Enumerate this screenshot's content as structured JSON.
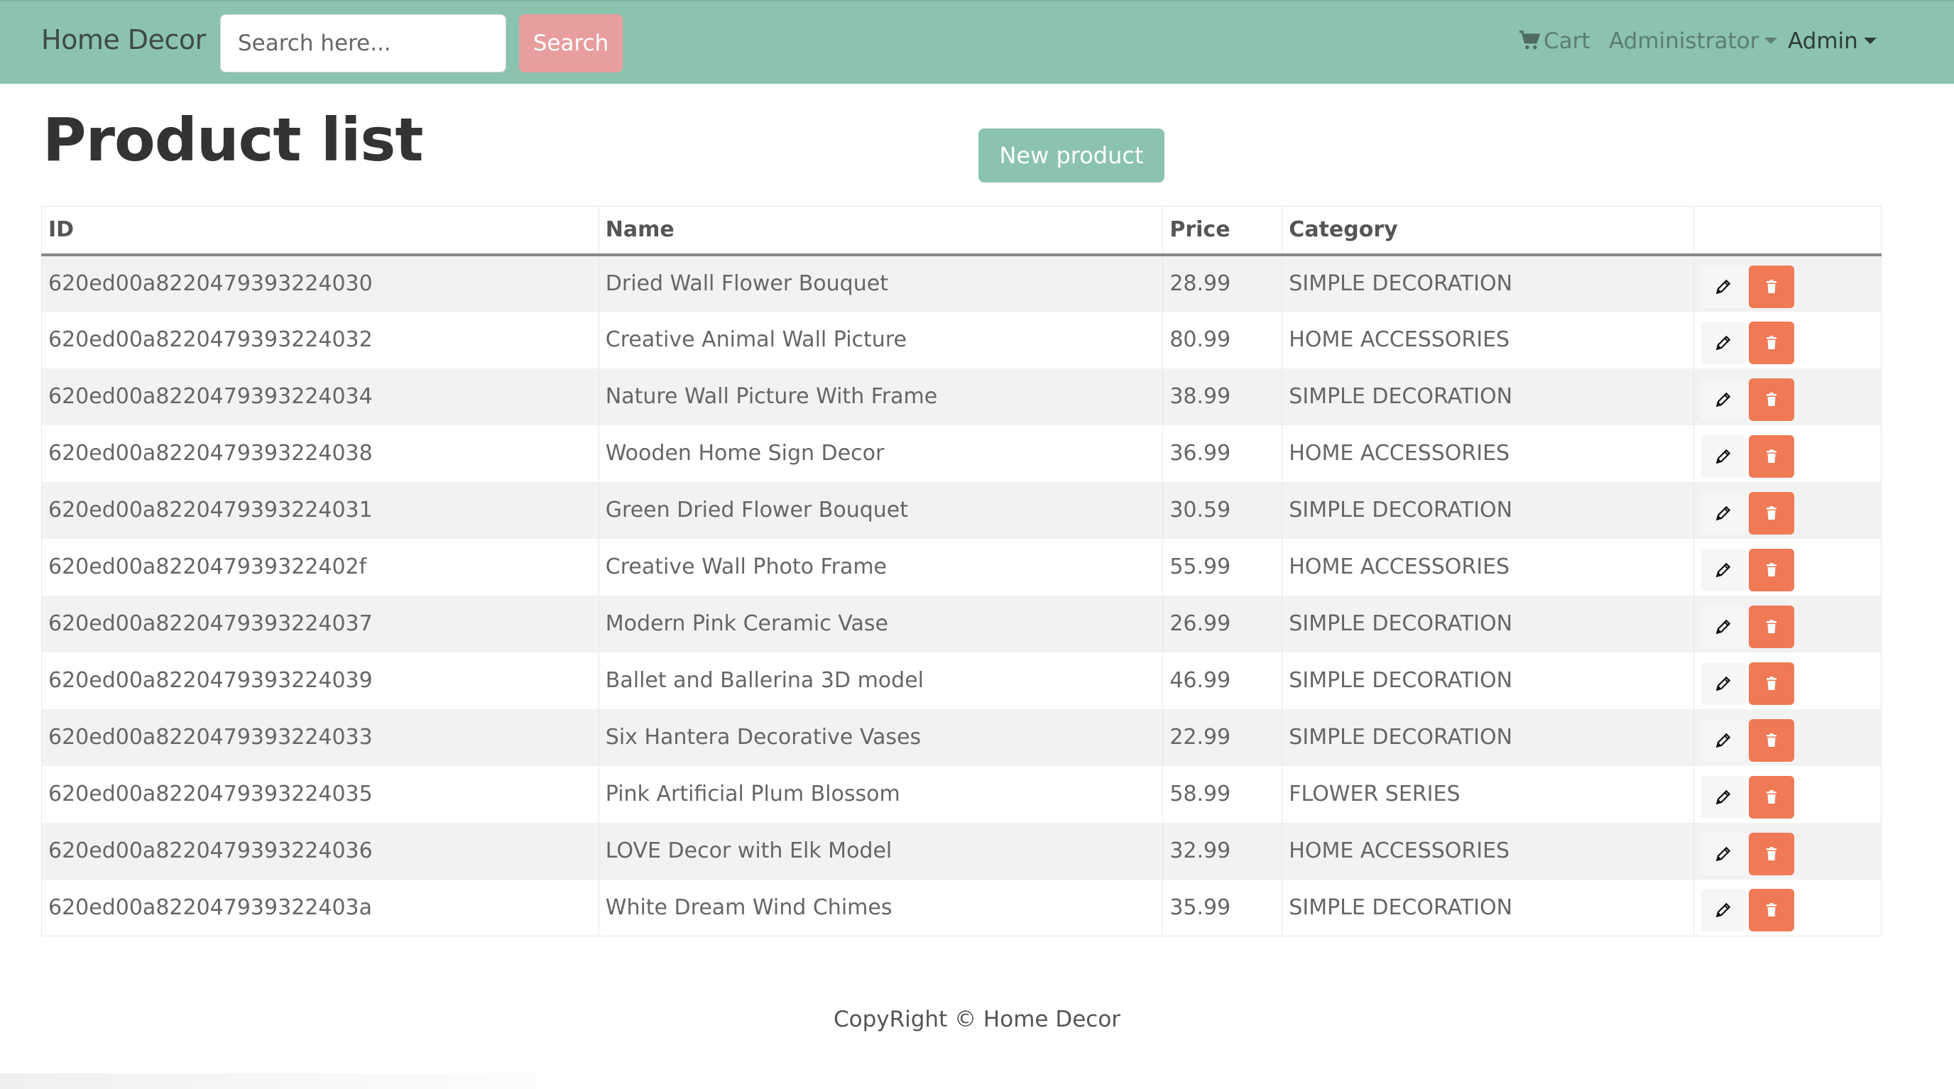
{
  "navbar": {
    "brand": "Home Decor",
    "search_placeholder": "Search here...",
    "search_button": "Search",
    "cart_label": "Cart",
    "admin_menu_label": "Administrator",
    "user_menu_label": "Admin",
    "background_color": "#8bc3af"
  },
  "page": {
    "title": "Product list",
    "new_product_button": "New product"
  },
  "table": {
    "headers": {
      "id": "ID",
      "name": "Name",
      "price": "Price",
      "category": "Category"
    },
    "rows": [
      {
        "id": "620ed00a8220479393224030",
        "name": "Dried Wall Flower Bouquet",
        "price": "28.99",
        "category": "SIMPLE DECORATION"
      },
      {
        "id": "620ed00a8220479393224032",
        "name": "Creative Animal Wall Picture",
        "price": "80.99",
        "category": "HOME ACCESSORIES"
      },
      {
        "id": "620ed00a8220479393224034",
        "name": "Nature Wall Picture With Frame",
        "price": "38.99",
        "category": "SIMPLE DECORATION"
      },
      {
        "id": "620ed00a8220479393224038",
        "name": "Wooden Home Sign Decor",
        "price": "36.99",
        "category": "HOME ACCESSORIES"
      },
      {
        "id": "620ed00a8220479393224031",
        "name": "Green Dried Flower Bouquet",
        "price": "30.59",
        "category": "SIMPLE DECORATION"
      },
      {
        "id": "620ed00a822047939322402f",
        "name": "Creative Wall Photo Frame",
        "price": "55.99",
        "category": "HOME ACCESSORIES"
      },
      {
        "id": "620ed00a8220479393224037",
        "name": "Modern Pink Ceramic Vase",
        "price": "26.99",
        "category": "SIMPLE DECORATION"
      },
      {
        "id": "620ed00a8220479393224039",
        "name": "Ballet and Ballerina 3D model",
        "price": "46.99",
        "category": "SIMPLE DECORATION"
      },
      {
        "id": "620ed00a8220479393224033",
        "name": "Six Hantera Decorative Vases",
        "price": "22.99",
        "category": "SIMPLE DECORATION"
      },
      {
        "id": "620ed00a8220479393224035",
        "name": "Pink Artificial Plum Blossom",
        "price": "58.99",
        "category": "FLOWER SERIES"
      },
      {
        "id": "620ed00a8220479393224036",
        "name": "LOVE Decor with Elk Model",
        "price": "32.99",
        "category": "HOME ACCESSORIES"
      },
      {
        "id": "620ed00a822047939322403a",
        "name": "White Dream Wind Chimes",
        "price": "35.99",
        "category": "SIMPLE DECORATION"
      }
    ],
    "edit_icon": "pencil-icon",
    "delete_icon": "trash-icon",
    "delete_color": "#ef7a55"
  },
  "footer": {
    "text": "CopyRight © Home Decor"
  }
}
